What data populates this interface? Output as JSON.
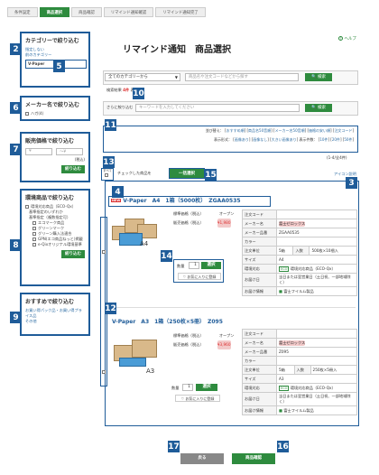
{
  "steps": [
    "条件設定",
    "商品選択",
    "商品確認",
    "リマインド通知確認",
    "リマインド通知完了"
  ],
  "badges": {
    "b2": "2",
    "b3": "3",
    "b4": "4",
    "b5": "5",
    "b6": "6",
    "b7": "7",
    "b8": "8",
    "b9": "9",
    "b10": "10",
    "b11": "11",
    "b12": "12",
    "b13": "13",
    "b14": "14",
    "b15": "15",
    "b16": "16",
    "b17": "17"
  },
  "help": "ヘルプ",
  "page_title": "リマインド通知　商品選択",
  "sidebar": {
    "category": {
      "title": "カテゴリーで絞り込む",
      "unset": "指定しない",
      "prev": "前のカテゴリー",
      "current": "V-Paper"
    },
    "maker": {
      "title": "メーカー名で絞り込む",
      "item": "ハガ(4)"
    },
    "price": {
      "title": "販売価格で絞り込む",
      "from": "¥",
      "to": "〜¥",
      "tax": "(税込)",
      "button": "絞り込む"
    },
    "eco": {
      "title": "環境商品で絞り込む",
      "o1": "環境対応商品（ECO-Qx）",
      "o2": "基準指定のいずれか",
      "o3": "基準指定（複数指定可）",
      "o4": "エコマーク商品",
      "o5": "グリーンマーク",
      "o6": "グリーン購入法適合",
      "o7": "GPN(エコ商品ねっと)掲載",
      "o8": "e-Qixオリジナル環境基準",
      "button": "絞り込む"
    },
    "recommend": {
      "title": "おすすめで絞り込む",
      "item": "お買い得パック品・お買い得プライス品",
      "more": "その他"
    }
  },
  "search": {
    "category_select": "全てのカテゴリーから",
    "placeholder": "商品名や注文コードなどから探す",
    "button": "検索",
    "result_label": "検索結果",
    "result_count": "4件",
    "result_suffix": "表示",
    "refine_label": "さらに絞り込む",
    "refine_placeholder": "キーワードを入力してください",
    "refine_button": "検索"
  },
  "sort": {
    "label": "並び替え：",
    "options": [
      "おすすめ順",
      "商品名50音順",
      "メーカー名50音順",
      "価格の安い順",
      "注文コード"
    ],
    "display_label": "表示形式：",
    "display_options": [
      "画像あり",
      "画像なし",
      "大きい画像あり"
    ],
    "per_page_label": "表示件数：",
    "per_page": [
      "10件",
      "20件",
      "50件"
    ],
    "paging": "(1-4/全4件)"
  },
  "bulk": {
    "select_all": "すべて",
    "checked_label": "チェックした商品を",
    "button": "一括選択",
    "icon_label": "アイコン説明"
  },
  "products": [
    {
      "new": "NEW",
      "name": "V-Paper　A4　1箱（5000枚）　ZGAA0535",
      "size_label": "A4",
      "std_price_label": "標準価格（税込）",
      "std_price": "オープン",
      "sale_price_label": "販売価格（税込）",
      "sale_price": "¥1,980",
      "qty_label": "数量",
      "qty": "1",
      "select": "選択",
      "fav": "お気に入りに登録",
      "specs": [
        [
          "注文コード",
          ""
        ],
        [
          "メーカー名",
          "富士ゼロックス"
        ],
        [
          "メーカー品番",
          "ZGAA0535"
        ],
        [
          "カラー",
          ""
        ],
        [
          "注文単位",
          "5箱",
          "入数",
          "500枚×10梱入"
        ],
        [
          "サイズ",
          "A4"
        ],
        [
          "環境対応",
          "ECO",
          "環境対応商品（ECO-Qx）"
        ],
        [
          "お届け日",
          "当日または翌営業日（土日祝、一部地域除く）"
        ],
        [
          "お届け情報",
          "富士フイルム製品"
        ]
      ]
    },
    {
      "new": "",
      "name": "V-Paper　A3　1箱（250枚×5冊）　Z095",
      "size_label": "A3",
      "std_price_label": "標準価格（税込）",
      "std_price": "オープン",
      "sale_price_label": "販売価格（税込）",
      "sale_price": "¥3,960",
      "qty_label": "数量",
      "qty": "1",
      "select": "選択",
      "fav": "お気に入りに登録",
      "specs": [
        [
          "注文コード",
          ""
        ],
        [
          "メーカー名",
          "富士ゼロックス"
        ],
        [
          "メーカー品番",
          "Z095"
        ],
        [
          "カラー",
          ""
        ],
        [
          "注文単位",
          "5箱",
          "入数",
          "250枚×5冊入"
        ],
        [
          "サイズ",
          "A3"
        ],
        [
          "環境対応",
          "ECO",
          "環境対応商品（ECO-Qx）"
        ],
        [
          "お届け日",
          "当日または翌営業日（土日祝、一部地域除く）"
        ],
        [
          "お届け情報",
          "富士フイルム製品"
        ]
      ]
    }
  ],
  "footer": {
    "back": "戻る",
    "confirm": "商品確認"
  }
}
